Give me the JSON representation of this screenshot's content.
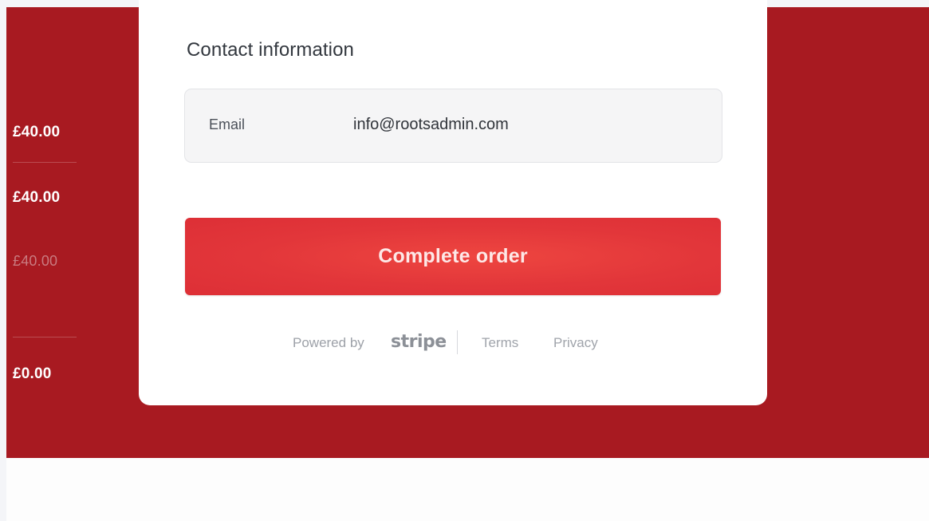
{
  "summary": {
    "line_1": "£40.00",
    "line_2": "£40.00",
    "line_3": "£40.00",
    "line_4": "£0.00"
  },
  "contact": {
    "title": "Contact information",
    "email_label": "Email",
    "email_value": "info@rootsadmin.com"
  },
  "actions": {
    "complete_order": "Complete order"
  },
  "footer": {
    "powered_by": "Powered by",
    "brand": "stripe",
    "terms": "Terms",
    "privacy": "Privacy"
  },
  "colors": {
    "panel": "#a81a21",
    "button": "#e2363a"
  }
}
